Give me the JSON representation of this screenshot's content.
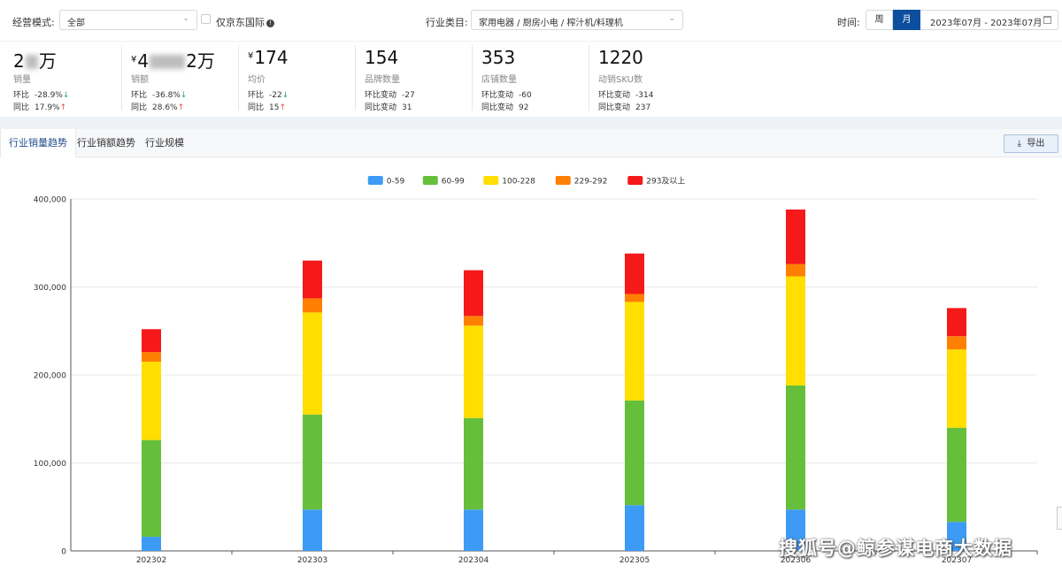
{
  "filters": {
    "mode_label": "经营模式:",
    "mode_value": "全部",
    "jd_intl_label": "仅京东国际",
    "category_label": "行业类目:",
    "category_value": "家用电器 / 厨房小电 / 榨汁机/料理机",
    "time_label": "时间:",
    "week_label": "周",
    "month_label": "月",
    "date_range": "2023年07月 - 2023年07月"
  },
  "kpis": [
    {
      "value_prefix": "2",
      "value_suffix": "万",
      "currency": "",
      "label": "销量",
      "row1_key": "环比",
      "row1_val": "-28.9%",
      "row1_arrow": "↓",
      "row2_key": "同比",
      "row2_val": "17.9%",
      "row2_arrow": "↑"
    },
    {
      "value_prefix": "4",
      "value_suffix": "2万",
      "currency": "¥",
      "label": "销额",
      "row1_key": "环比",
      "row1_val": "-36.8%",
      "row1_arrow": "↓",
      "row2_key": "同比",
      "row2_val": "28.6%",
      "row2_arrow": "↑"
    },
    {
      "value_prefix": "174",
      "value_suffix": "",
      "currency": "¥",
      "label": "均价",
      "row1_key": "环比",
      "row1_val": "-22",
      "row1_arrow": "↓",
      "row2_key": "同比",
      "row2_val": "15",
      "row2_arrow": "↑"
    },
    {
      "value_prefix": "154",
      "value_suffix": "",
      "currency": "",
      "label": "品牌数量",
      "row1_key": "环比变动",
      "row1_val": "-27",
      "row1_arrow": "",
      "row2_key": "同比变动",
      "row2_val": "31",
      "row2_arrow": ""
    },
    {
      "value_prefix": "353",
      "value_suffix": "",
      "currency": "",
      "label": "店铺数量",
      "row1_key": "环比变动",
      "row1_val": "-60",
      "row1_arrow": "",
      "row2_key": "同比变动",
      "row2_val": "92",
      "row2_arrow": ""
    },
    {
      "value_prefix": "1220",
      "value_suffix": "",
      "currency": "",
      "label": "动销SKU数",
      "row1_key": "环比变动",
      "row1_val": "-314",
      "row1_arrow": "",
      "row2_key": "同比变动",
      "row2_val": "237",
      "row2_arrow": ""
    }
  ],
  "tabs": [
    {
      "label": "行业销量趋势"
    },
    {
      "label": "行业销额趋势"
    },
    {
      "label": "行业规模"
    }
  ],
  "export_label": "导出",
  "watermark": "搜狐号@鲸参谋电商大数据",
  "colors": {
    "accent": "#0d4f9e",
    "series": [
      "#3d9bf5",
      "#66bf3b",
      "#ffde00",
      "#ff8000",
      "#f5191a"
    ]
  },
  "chart_data": {
    "type": "bar",
    "stacked": true,
    "categories": [
      "202302",
      "202303",
      "202304",
      "202305",
      "202306",
      "202307"
    ],
    "series": [
      {
        "name": "0-59",
        "values": [
          16000,
          47000,
          47000,
          52000,
          47000,
          33000
        ]
      },
      {
        "name": "60-99",
        "values": [
          110000,
          108000,
          104000,
          119000,
          141000,
          107000
        ]
      },
      {
        "name": "100-228",
        "values": [
          89000,
          116000,
          105000,
          112000,
          124000,
          89000
        ]
      },
      {
        "name": "229-292",
        "values": [
          11000,
          16000,
          11000,
          9000,
          14000,
          15000
        ]
      },
      {
        "name": "293及以上",
        "values": [
          26000,
          43000,
          52000,
          46000,
          62000,
          32000
        ]
      }
    ],
    "yticks": [
      "0",
      "100,000",
      "200,000",
      "300,000",
      "400,000"
    ],
    "ylim": [
      0,
      400000
    ],
    "legend_position": "top-center",
    "grid": true
  }
}
